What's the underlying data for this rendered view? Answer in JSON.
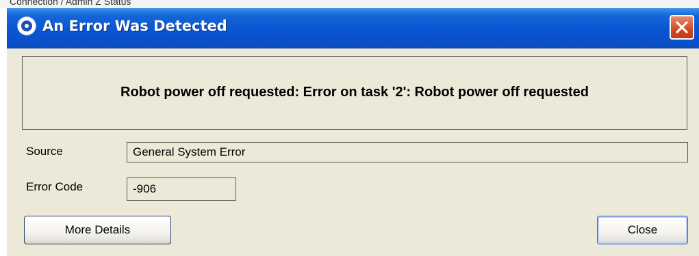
{
  "background": {
    "top_text": "Connection / Admin  Z  Status"
  },
  "dialog": {
    "title": "An Error Was Detected",
    "message": "Robot power off requested: Error on task '2': Robot power off requested",
    "source_label": "Source",
    "source_value": "General System Error",
    "error_code_label": "Error Code",
    "error_code_value": "-906",
    "more_details_label": "More Details",
    "close_label": "Close"
  },
  "colors": {
    "titlebar": "#0a55d2",
    "dialog_bg": "#ece9d8",
    "close_button": "#d04a22"
  },
  "icons": {
    "app": "app-logo-icon",
    "close": "close-x-icon"
  }
}
